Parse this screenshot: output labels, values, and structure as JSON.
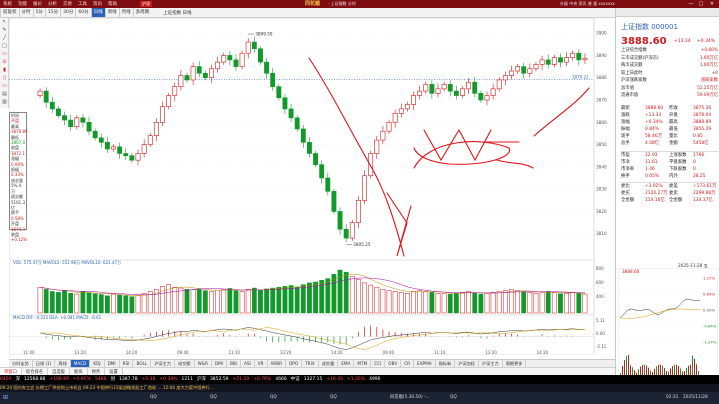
{
  "titlebar": {
    "menu": [
      "系统",
      "功能",
      "报价",
      "分析",
      "交易",
      "工具",
      "资讯",
      "帮助"
    ],
    "tab_badge": "沪深",
    "brand": "同花顺",
    "brand_sub": "· 上证指数 分时",
    "right_text": "升级 中央 资讯 普 量 xxxxxxx",
    "window_controls": [
      "—",
      "□",
      "✕"
    ]
  },
  "toolbar": {
    "buttons": [
      "前复权",
      "分时",
      "5分",
      "15分",
      "30分",
      "60分",
      "日线",
      "周线",
      "月线",
      "多周期"
    ],
    "active_tab": "日线",
    "chart_header": "上证指数 日线"
  },
  "left_tools": [
    "↖",
    "✎",
    "╱",
    "□",
    "▭",
    "⊙",
    "▮",
    "▯",
    "▭",
    "▤",
    "▥"
  ],
  "infobox": {
    "lines": [
      {
        "label": "时间",
        "value": ""
      },
      {
        "label": "开盘",
        "value": "3874.07",
        "cls": "up"
      },
      {
        "label": "最高",
        "value": "",
        "cls": ""
      },
      {
        "label": "3879.89",
        "value": "",
        "cls": "up"
      },
      {
        "label": "最低",
        "value": ""
      },
      {
        "label": "3867.0",
        "value": "",
        "cls": "dn"
      },
      {
        "label": "收盘",
        "value": ""
      },
      {
        "label": "3872.1",
        "value": "",
        "cls": "up"
      },
      {
        "label": "涨幅",
        "value": ""
      },
      {
        "label": "0.09%",
        "value": "",
        "cls": "up"
      },
      {
        "label": "振幅",
        "value": ""
      },
      {
        "label": "0.33%",
        "value": "",
        "cls": "up"
      },
      {
        "label": "成交量",
        "value": ""
      },
      {
        "label": "5%,4万",
        "value": ""
      },
      {
        "label": "成交额",
        "value": ""
      },
      {
        "label": "5161.3亿",
        "value": ""
      },
      {
        "label": "换手",
        "value": ""
      },
      {
        "label": "0.58%",
        "value": "",
        "cls": "up"
      },
      {
        "label": "开盘",
        "value": ""
      },
      {
        "label": "3874.3",
        "value": "",
        "cls": "up"
      },
      {
        "label": "收盘",
        "value": ""
      },
      {
        "label": "+0.12%",
        "value": "",
        "cls": "up"
      }
    ]
  },
  "chart": {
    "high_label": "3899.59",
    "low_label": "3805.25",
    "ma_line_label": "3879.22",
    "price_ticks": [
      "3900",
      "3890",
      "3880",
      "3870",
      "3860",
      "3850",
      "3840",
      "3830",
      "3820",
      "3810"
    ],
    "volume_header": "VOL: 575.47万  MAVOL5: 551.96万  MAVOL10: 621.47万",
    "volume_ticks": [
      "800",
      "600",
      "400"
    ],
    "macd_header": "MACD   DIF: -0.225  DEA: +0.081  MACD: -0.61",
    "macd_ticks": [
      "5.11",
      "0.00",
      "-5.11"
    ],
    "time_ticks": [
      "11:00",
      "13:20",
      "14:20",
      "09:40",
      "11:10",
      "13:20",
      "14:20",
      "09:40",
      "11:10",
      "13:20",
      "14:20"
    ],
    "vol_tab": "成交量",
    "macd_tab": "MACD"
  },
  "chart_data": {
    "type": "bar",
    "title": "",
    "candles_open": [
      3872,
      3874,
      3869,
      3866,
      3863,
      3861,
      3858,
      3862,
      3860,
      3856,
      3853,
      3851,
      3848,
      3849,
      3846,
      3845,
      3843,
      3846,
      3850,
      3854,
      3860,
      3867,
      3872,
      3876,
      3881,
      3879,
      3885,
      3882,
      3880,
      3884,
      3887,
      3890,
      3888,
      3885,
      3891,
      3896,
      3893,
      3887,
      3882,
      3876,
      3871,
      3866,
      3862,
      3857,
      3851,
      3846,
      3841,
      3835,
      3829,
      3820,
      3812,
      3808,
      3815,
      3825,
      3836,
      3846,
      3852,
      3856,
      3860,
      3864,
      3866,
      3868,
      3872,
      3874,
      3877,
      3873,
      3875,
      3877,
      3874,
      3872,
      3875,
      3878,
      3873,
      3870,
      3872,
      3875,
      3879,
      3881,
      3883,
      3885,
      3882,
      3884,
      3886,
      3888,
      3886,
      3889,
      3887,
      3889,
      3891,
      3888
    ],
    "candles_close": [
      3874,
      3869,
      3866,
      3863,
      3861,
      3858,
      3862,
      3860,
      3856,
      3853,
      3851,
      3848,
      3849,
      3846,
      3845,
      3843,
      3846,
      3850,
      3854,
      3860,
      3867,
      3872,
      3876,
      3881,
      3879,
      3885,
      3882,
      3880,
      3884,
      3887,
      3890,
      3888,
      3885,
      3891,
      3896,
      3893,
      3887,
      3882,
      3876,
      3871,
      3866,
      3862,
      3857,
      3851,
      3846,
      3841,
      3835,
      3829,
      3820,
      3812,
      3808,
      3815,
      3825,
      3836,
      3846,
      3852,
      3856,
      3860,
      3864,
      3866,
      3868,
      3872,
      3874,
      3877,
      3873,
      3875,
      3877,
      3874,
      3872,
      3875,
      3878,
      3873,
      3870,
      3872,
      3875,
      3879,
      3881,
      3883,
      3885,
      3882,
      3884,
      3886,
      3888,
      3886,
      3889,
      3887,
      3889,
      3891,
      3888,
      3888.6
    ],
    "volume": [
      60,
      55,
      50,
      48,
      52,
      46,
      44,
      50,
      47,
      45,
      43,
      40,
      44,
      42,
      40,
      38,
      41,
      45,
      50,
      55,
      62,
      66,
      60,
      58,
      55,
      54,
      56,
      52,
      50,
      53,
      55,
      57,
      52,
      50,
      55,
      58,
      54,
      56,
      58,
      60,
      62,
      64,
      60,
      66,
      70,
      72,
      76,
      80,
      90,
      100,
      95,
      85,
      78,
      70,
      65,
      60,
      55,
      52,
      50,
      48,
      46,
      50,
      52,
      50,
      48,
      46,
      45,
      44,
      46,
      48,
      50,
      47,
      44,
      46,
      48,
      50,
      52,
      54,
      52,
      50,
      48,
      46,
      48,
      50,
      47,
      45,
      46,
      48,
      46,
      44
    ],
    "ylim": [
      3800,
      3905
    ]
  },
  "right": {
    "title": "上证指数 000001",
    "price": "3888.60",
    "change": "+13.34",
    "pct": "+0.34%",
    "list": [
      {
        "k": "上证综合指数",
        "v": "+0.60%"
      },
      {
        "k": "三市成交额(沪深京)",
        "v": "1.60万亿"
      },
      {
        "k": "两市成交额",
        "v": "1.60万亿"
      },
      {
        "k": "较上日此时",
        "v": "+0"
      },
      {
        "k": "沪深涨跌家数",
        "v": "涨跌家数"
      },
      {
        "k": "总市值",
        "v": "52.25万亿"
      },
      {
        "k": "流通市值",
        "v": "59.09万亿"
      }
    ],
    "grid": [
      [
        "最新",
        "3888.60",
        "昨收",
        "3875.26"
      ],
      [
        "涨跌",
        "+13.34",
        "开盘",
        "3878.04"
      ],
      [
        "涨幅",
        "+0.34%",
        "最高",
        "3888.89"
      ],
      [
        "振幅",
        "0.84%",
        "最低",
        "3855.29"
      ],
      [
        "现手",
        "58.46万",
        "量比",
        "0.85"
      ],
      [
        "总手",
        "4.58亿",
        "金额",
        "5458亿"
      ]
    ],
    "grid2": [
      [
        "市盈",
        "12.93",
        "上涨家数",
        "1766"
      ],
      [
        "市净",
        "11.61",
        "平盘家数",
        "0"
      ],
      [
        "市净率",
        "1.46",
        "下跌家数",
        "0"
      ],
      [
        "换手",
        "0.05%",
        "内外",
        "28.25"
      ]
    ],
    "bottom": [
      [
        "委比",
        "+3.92%",
        "委差",
        "+173.61万"
      ],
      [
        "委买",
        "2120.27万",
        "委卖",
        "2299.88万"
      ],
      [
        "全金额",
        "114.16亿",
        "全金额",
        "134.37亿"
      ]
    ],
    "mini_date": "2025-11-28 五",
    "mini_price_label": "3888.60",
    "mini_pct_ticks": [
      "1.27%",
      "0.64%",
      "0.00%",
      "-0.64%",
      "-1.27%"
    ]
  },
  "bottomtabs": [
    "分时走势",
    "日线 (1)",
    "周线",
    "MACD",
    "KDJ",
    "DMI",
    "RSI",
    "BOLL",
    "沪深主力",
    "成交额",
    "W&R",
    "DMI",
    "BBI",
    "ASI",
    "VR",
    "ARBR",
    "DPO",
    "TRIX",
    "成交量",
    "EMA",
    "MTM",
    "CCI",
    "OBV",
    "CR",
    "EXPMA",
    "指标新",
    "沪深加权",
    "沪深主力",
    "周期更多"
  ],
  "active_bottomtab": "MACD",
  "sheetrow": [
    "单窗口",
    "综合排名",
    "自选股",
    "板块",
    "财务",
    "设置"
  ],
  "ticker": [
    {
      "t": "6450",
      "c": "red"
    },
    {
      "t": "深",
      "c": ""
    },
    {
      "t": "12568.88",
      "c": ""
    },
    {
      "t": "+108.89",
      "c": "red"
    },
    {
      "t": "+0.85%",
      "c": "red"
    },
    {
      "t": "5486",
      "c": "red"
    },
    {
      "t": "创",
      "c": ""
    },
    {
      "t": "1387.78",
      "c": ""
    },
    {
      "t": "+5.38",
      "c": "red"
    },
    {
      "t": "+0.39%",
      "c": "red"
    },
    {
      "t": "1211",
      "c": ""
    },
    {
      "t": "沪深",
      "c": ""
    },
    {
      "t": "3852.59",
      "c": ""
    },
    {
      "t": "+21.29",
      "c": "red"
    },
    {
      "t": "+0.76%",
      "c": "red"
    },
    {
      "t": "4666",
      "c": ""
    },
    {
      "t": "中证",
      "c": ""
    },
    {
      "t": "1327.15",
      "c": ""
    },
    {
      "t": "+16.45",
      "c": "red"
    },
    {
      "t": "+1.26%",
      "c": "red"
    },
    {
      "t": "4996",
      "c": ""
    }
  ],
  "news": "09:24 国内车工会 长期工厂供给和上市机会  09:23 中国央行15架战略发起工厂首轮 ...  12:04 加大力度中国央行...",
  "taskbar": {
    "items": [
      "QQ",
      "QQ",
      "QQ",
      "QQ",
      "同花顺(5.30.50) -...",
      "QQ"
    ],
    "clock": "02:31",
    "date": "2025/11/28"
  }
}
